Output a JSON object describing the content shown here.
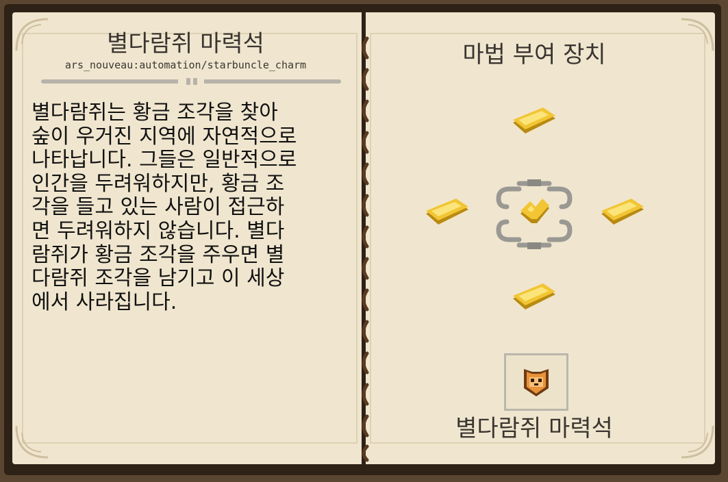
{
  "left_page": {
    "title": "별다람쥐 마력석",
    "subtitle": "ars_nouveau:automation/starbuncle_charm",
    "body": "별다람쥐는 황금 조각을 찾아\n숲이 우거진 지역에 자연적으로\n나타납니다. 그들은 일반적으로\n인간을 두려워하지만, 황금 조\n각을 들고 있는 사람이 접근하\n면 두려워하지 않습니다. 별다\n람쥐가 황금 조각을 주우면 별\n다람쥐 조각을 남기고 이 세상\n에서 사라집니다."
  },
  "right_page": {
    "title": "마법 부여 장치",
    "output_label": "별다람쥐 마력석",
    "ingredients": [
      {
        "slot": "top",
        "icon": "gold-ingot-icon"
      },
      {
        "slot": "left",
        "icon": "gold-ingot-icon"
      },
      {
        "slot": "right",
        "icon": "gold-ingot-icon"
      },
      {
        "slot": "bottom",
        "icon": "gold-ingot-icon"
      }
    ],
    "center_icon": "gold-nugget-icon",
    "apparatus_icon": "enchanting-apparatus-icon",
    "output_icon": "starbuncle-charm-icon"
  },
  "colors": {
    "page": "#f0e6cf",
    "text": "#111111",
    "heading": "#3a3530",
    "gold": "#f2c534",
    "spine_stitch": "#5a3a22"
  }
}
